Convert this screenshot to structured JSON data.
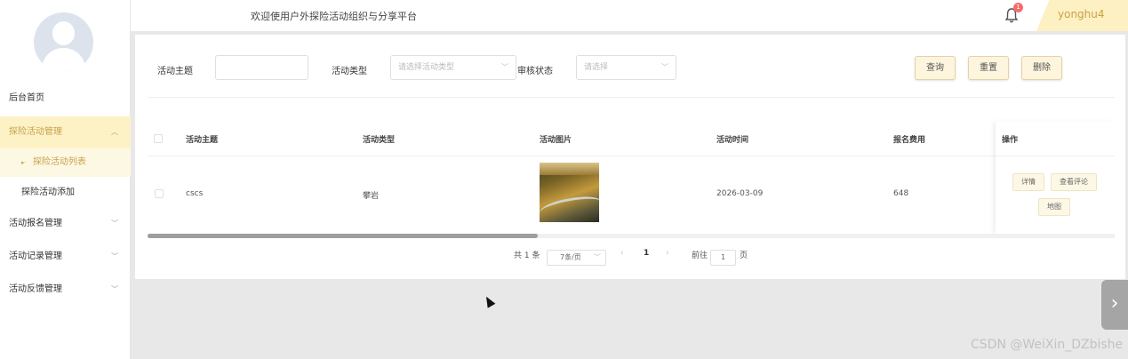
{
  "header": {
    "welcome": "欢迎使用户外探险活动组织与分享平台",
    "notification_count": "1",
    "username": "yonghu4"
  },
  "sidebar": {
    "items": [
      {
        "label": "后台首页"
      },
      {
        "label": "探险活动管理",
        "expanded": true,
        "children": [
          {
            "label": "探险活动列表",
            "active": true
          },
          {
            "label": "探险活动添加"
          }
        ]
      },
      {
        "label": "活动报名管理"
      },
      {
        "label": "活动记录管理"
      },
      {
        "label": "活动反馈管理"
      }
    ]
  },
  "filters": {
    "topic_label": "活动主题",
    "topic_value": "",
    "type_label": "活动类型",
    "type_placeholder": "请选择活动类型",
    "status_label": "审核状态",
    "status_placeholder": "请选择"
  },
  "actions": {
    "search": "查询",
    "reset": "重置",
    "delete": "删除"
  },
  "table": {
    "columns": [
      "活动主题",
      "活动类型",
      "活动图片",
      "活动时间",
      "报名费用",
      "操作"
    ],
    "rows": [
      {
        "topic": "cscs",
        "type": "攀岩",
        "date": "2026-03-09",
        "fee": "648",
        "ops": {
          "detail": "详情",
          "comments": "查看评论",
          "map": "地图"
        }
      }
    ]
  },
  "pagination": {
    "total": "共 1 条",
    "page_size": "7条/页",
    "current_page": "1",
    "goto_label": "前往",
    "goto_value": "1",
    "page_suffix": "页"
  },
  "watermark": "CSDN @WeiXin_DZbishe"
}
